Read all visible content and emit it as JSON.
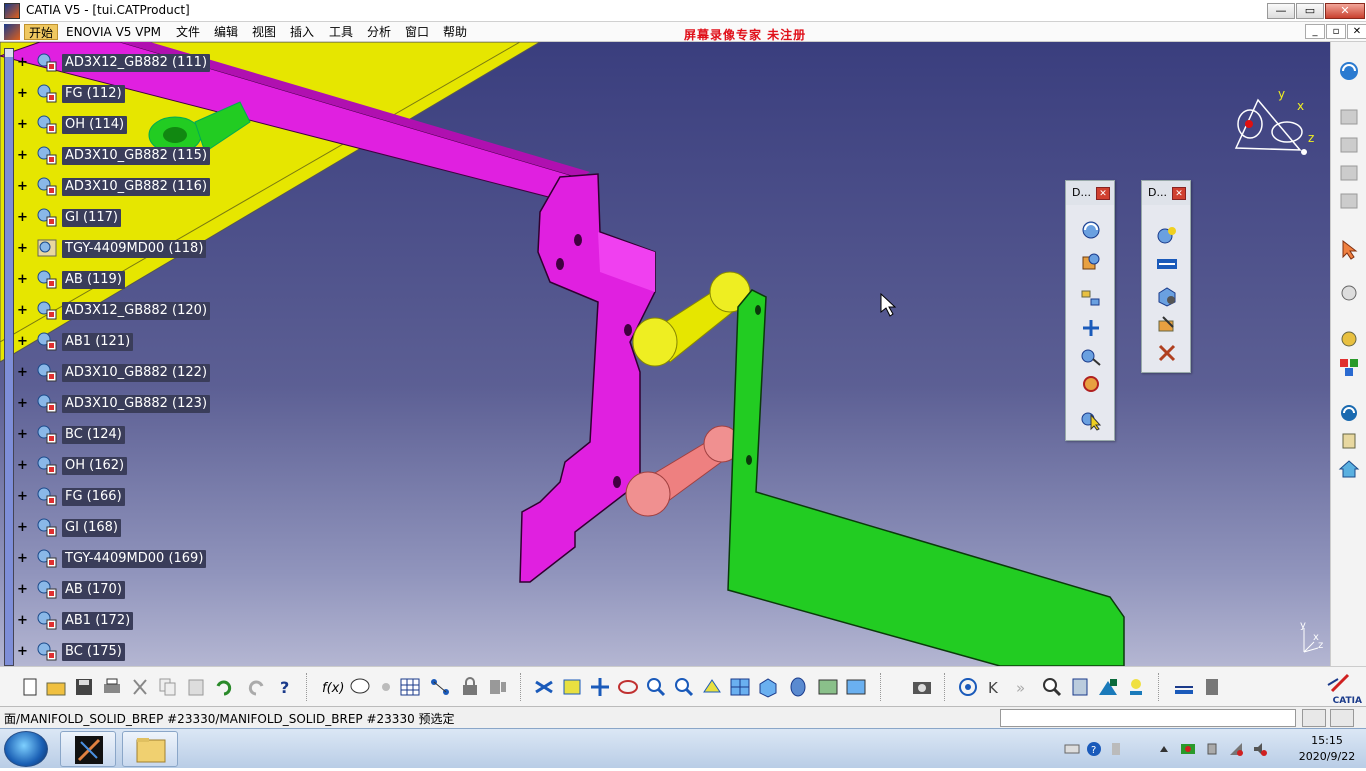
{
  "window": {
    "title": "CATIA V5 - [tui.CATProduct]",
    "controls": {
      "minimize": "—",
      "maximize": "▭",
      "close": "✕"
    }
  },
  "menubar": {
    "items": [
      "开始",
      "ENOVIA V5 VPM",
      "文件",
      "编辑",
      "视图",
      "插入",
      "工具",
      "分析",
      "窗口",
      "帮助"
    ],
    "watermark": "屏幕录像专家   未注册"
  },
  "tree": {
    "nodes": [
      {
        "label": "AD3X12_GB882 (111)"
      },
      {
        "label": "FG (112)"
      },
      {
        "label": "OH (114)"
      },
      {
        "label": "AD3X10_GB882 (115)"
      },
      {
        "label": "AD3X10_GB882 (116)"
      },
      {
        "label": "GI (117)"
      },
      {
        "label": "TGY-4409MD00 (118)"
      },
      {
        "label": "AB (119)"
      },
      {
        "label": "AD3X12_GB882 (120)"
      },
      {
        "label": "AB1 (121)"
      },
      {
        "label": "AD3X10_GB882 (122)"
      },
      {
        "label": "AD3X10_GB882 (123)"
      },
      {
        "label": "BC (124)"
      },
      {
        "label": "OH (162)"
      },
      {
        "label": "FG (166)"
      },
      {
        "label": "GI (168)"
      },
      {
        "label": "TGY-4409MD00 (169)"
      },
      {
        "label": "AB (170)"
      },
      {
        "label": "AB1 (172)"
      },
      {
        "label": "BC (175)"
      }
    ]
  },
  "compass": {
    "x_label": "x",
    "y_label": "y",
    "z_label": "z"
  },
  "axis_triad": {
    "x_label": "x",
    "y_label": "y",
    "z_label": "z"
  },
  "floating_toolbars": [
    {
      "title": "D...",
      "tools": [
        "manipulation-icon",
        "snap-icon",
        "explode-icon",
        "clash-icon",
        "constraint-icon",
        "stop-clash-icon",
        "select-icon"
      ]
    },
    {
      "title": "D...",
      "tools": [
        "component-icon",
        "fast-multi-instantiation-icon",
        "existing-component-icon",
        "replace-component-icon",
        "graph-tree-icon"
      ]
    }
  ],
  "bottom_toolbar": {
    "tools": [
      "new-icon",
      "open-icon",
      "save-icon",
      "print-icon",
      "cut-icon",
      "copy-icon",
      "paste-icon",
      "undo-icon",
      "redo-icon",
      "whats-this-icon",
      "formula-icon",
      "comment-icon",
      "knowledge-icon",
      "table-icon",
      "workbench-icon",
      "lock-icon",
      "catalog-icon",
      "fly-mode-icon",
      "fit-all-icon",
      "pan-icon",
      "rotate-icon",
      "zoom-in-icon",
      "zoom-out-icon",
      "normal-view-icon",
      "multi-view-icon",
      "iso-view-icon",
      "shading-icon",
      "hide-show-icon",
      "swap-icon",
      "capture-icon",
      "compass-icon",
      "previous-icon",
      "next-icon",
      "magnifier-icon",
      "measure-icon",
      "apply-material-icon",
      "light-icon",
      "measure-between-icon",
      "ruler-icon"
    ],
    "brand": "CATIA"
  },
  "status": {
    "message": "面/MANIFOLD_SOLID_BREP #23330/MANIFOLD_SOLID_BREP #23330 预选定",
    "command_input": ""
  },
  "taskbar": {
    "apps": [
      "catia-app-icon",
      "file-explorer-icon"
    ],
    "time": "15:15",
    "date": "2020/9/22"
  }
}
